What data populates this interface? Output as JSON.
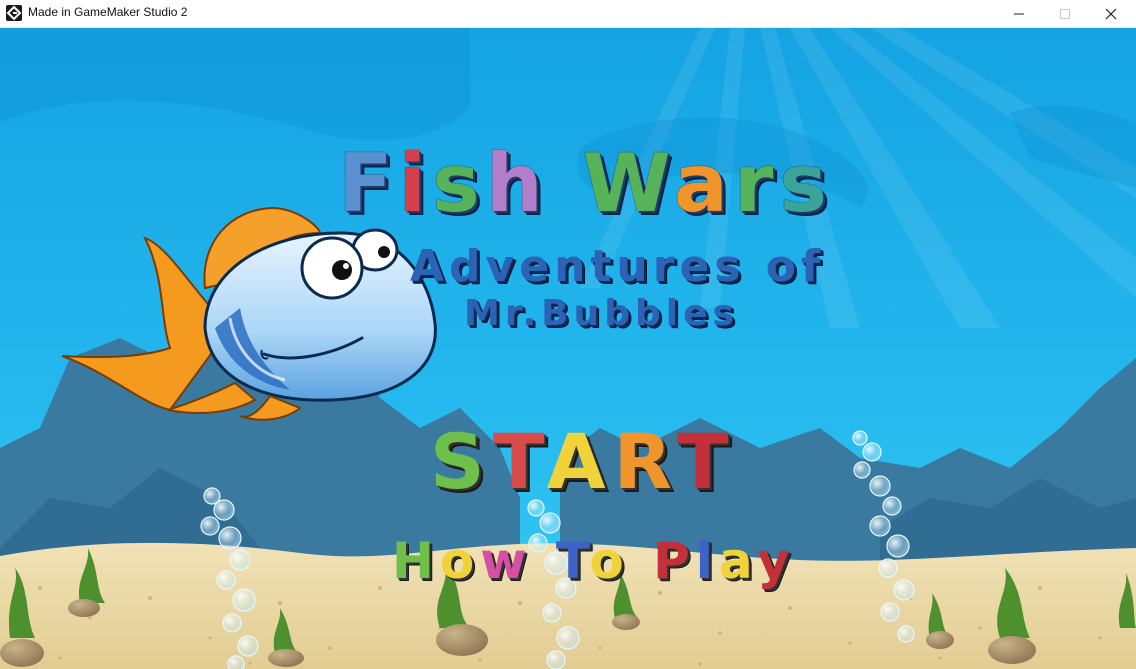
{
  "window": {
    "title": "Made in GameMaker Studio 2",
    "icon": "gamemaker-icon",
    "controls": [
      "minimize-icon",
      "maximize-icon",
      "close-icon"
    ]
  },
  "game": {
    "title_line1": "Fish Wars",
    "title_line1_colors": [
      "#5a8fd0",
      "#d6404a",
      "#57b35a",
      "#b37ec9",
      "#57b35a",
      "#f0952c",
      "#57b35a",
      "#3aa39a",
      "#f06a3a"
    ],
    "subtitle_line1": "Adventures of",
    "subtitle_line2": "Mr.Bubbles",
    "subtitle_color": "#2d63b4",
    "character": "fish-mascot",
    "menu": {
      "start_label": "START",
      "start_colors": [
        "#6fc04a",
        "#d94b4b",
        "#f0d23a",
        "#f0952c",
        "#c3303a"
      ],
      "howto_label": "How To Play",
      "howto_colors": [
        "#6fc04a",
        "#f0d23a",
        "#d64fa5",
        "#3b63c9",
        "#f0d23a",
        "#c3303a",
        "#3b63c9",
        "#f0d23a",
        "#c3303a",
        "#f0d23a",
        "#f0d23a"
      ]
    }
  },
  "colors": {
    "sky_top": "#1aa6e6",
    "sky_bottom": "#31c8f2",
    "sand": "#e8d6a5",
    "rock": "#3d7ea3"
  }
}
